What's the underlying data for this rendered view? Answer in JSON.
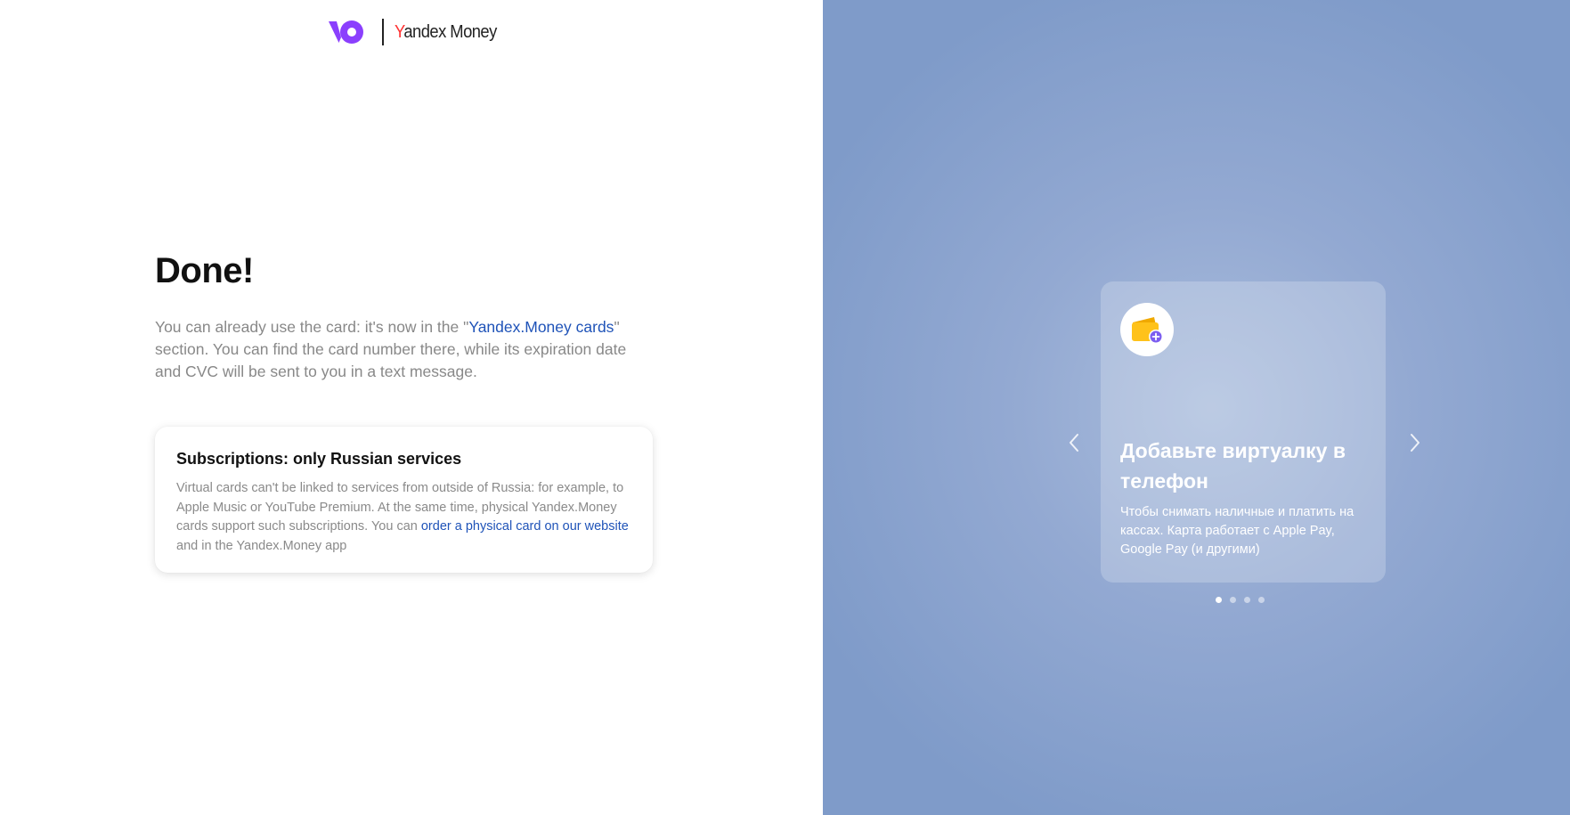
{
  "header": {
    "brand_y": "Y",
    "brand_rest": "andex Money"
  },
  "main": {
    "title": "Done!",
    "description_before_link": "You can already use the card: it's now in the \"",
    "description_link": "Yandex.Money cards",
    "description_after_link": "\" section. You can find the card number there, while its expiration date and CVC will be sent to you in a text message."
  },
  "info_card": {
    "title": "Subscriptions: only Russian services",
    "body_before_link": "Virtual cards can't be linked to services from outside of Russia: for example, to Apple Music or YouTube Premium. At the same time, physical Yandex.Money cards support such subscriptions. You can ",
    "body_link": "order a physical card on our website",
    "body_after_link": " and in the Yandex.Money app"
  },
  "promo": {
    "icon": "wallet-add-icon",
    "title": "Добавьте виртуалку в телефон",
    "text": "Чтобы снимать наличные и платить на кассах. Карта работает с Apple Pay, Google Pay (и другими)",
    "slide_count": 4,
    "active_slide": 1
  },
  "colors": {
    "brand_purple": "#8b3ffd",
    "link_blue": "#1f53b8",
    "panel_blue": "#8aa2cd",
    "wallet_yellow": "#ffc21a",
    "badge_purple": "#7b5cf0"
  }
}
